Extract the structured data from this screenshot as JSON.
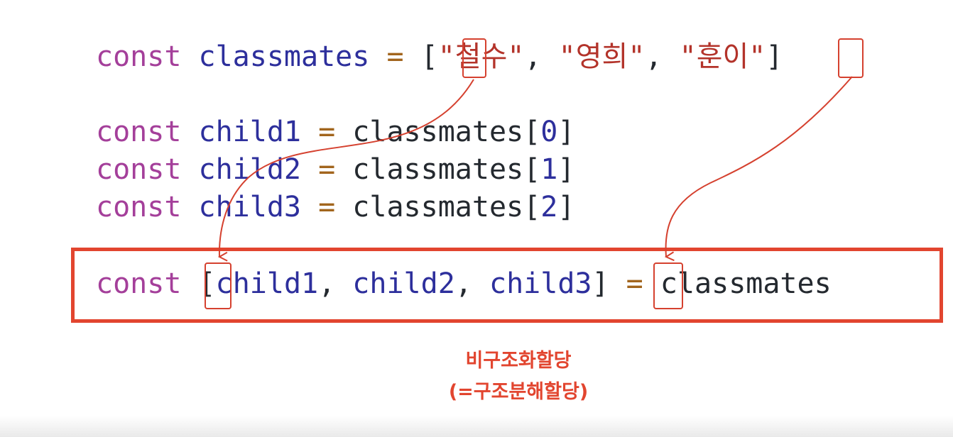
{
  "code": {
    "line1": {
      "kw": "const",
      "name": "classmates",
      "eq": "=",
      "open": "[",
      "s1": "\"철수\"",
      "s2": "\"영희\"",
      "s3": "\"훈이\"",
      "comma": ",",
      "close": "]"
    },
    "line2": {
      "kw": "const",
      "name": "child1",
      "eq": "=",
      "src": "classmates",
      "open": "[",
      "idx": "0",
      "close": "]"
    },
    "line3": {
      "kw": "const",
      "name": "child2",
      "eq": "=",
      "src": "classmates",
      "open": "[",
      "idx": "1",
      "close": "]"
    },
    "line4": {
      "kw": "const",
      "name": "child3",
      "eq": "=",
      "src": "classmates",
      "open": "[",
      "idx": "2",
      "close": "]"
    },
    "line5": {
      "kw": "const",
      "open": "[",
      "v1": "child1",
      "v2": "child2",
      "v3": "child3",
      "comma": ",",
      "close": "]",
      "eq": "=",
      "src": "classmates"
    }
  },
  "caption": {
    "line1": "비구조화할당",
    "line2": "(=구조분해할당)"
  },
  "colors": {
    "keyword": "#a43f9a",
    "identifier": "#2d2f9c",
    "operator": "#a2651d",
    "string": "#b3332a",
    "plain": "#24292f",
    "highlight": "#e2452f"
  }
}
